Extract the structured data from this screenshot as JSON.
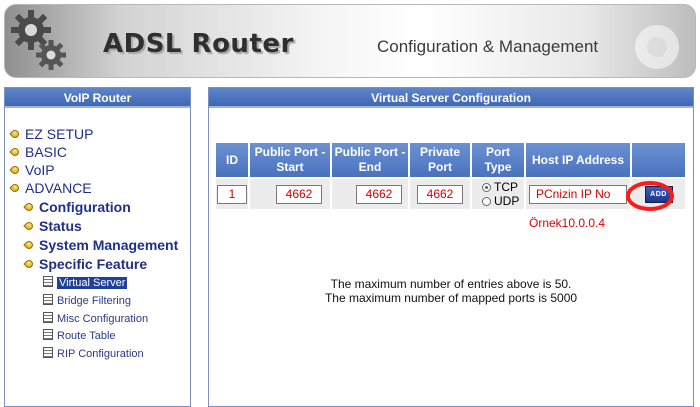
{
  "header": {
    "brand": "ADSL Router",
    "tagline": "Configuration & Management"
  },
  "sidebar": {
    "title": "VoIP Router",
    "items": [
      {
        "label": "EZ SETUP"
      },
      {
        "label": "BASIC"
      },
      {
        "label": "VoIP"
      },
      {
        "label": "ADVANCE"
      },
      {
        "label": "Configuration"
      },
      {
        "label": "Status"
      },
      {
        "label": "System Management"
      },
      {
        "label": "Specific Feature"
      },
      {
        "label": "Virtual Server",
        "selected": true
      },
      {
        "label": "Bridge Filtering"
      },
      {
        "label": "Misc Configuration"
      },
      {
        "label": "Route Table"
      },
      {
        "label": "RIP Configuration"
      }
    ]
  },
  "main": {
    "title": "Virtual Server Configuration",
    "columns": [
      "ID",
      "Public Port - Start",
      "Public Port - End",
      "Private Port",
      "Port Type",
      "Host IP Address",
      ""
    ],
    "row": {
      "id": "1",
      "public_start": "4662",
      "public_end": "4662",
      "private_port": "4662",
      "port_type_options": [
        "TCP",
        "UDP"
      ],
      "port_type_selected": "TCP",
      "host_ip": "PCnizin IP No",
      "add_label": "ADD"
    },
    "annotation": "Örnek10.0.0.4",
    "notes": [
      "The maximum number of entries above is 50.",
      "The maximum number of mapped ports is 5000"
    ]
  },
  "colors": {
    "panel_header": "#4a72bd",
    "annotation_red": "#e60000",
    "input_text": "#d40000"
  }
}
